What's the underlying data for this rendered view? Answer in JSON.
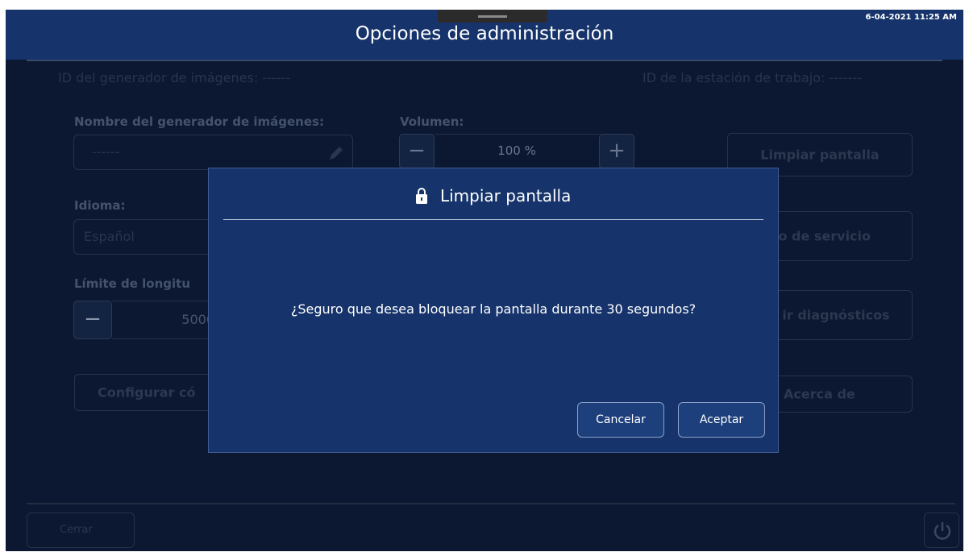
{
  "header": {
    "title": "Opciones de administración",
    "clock": "6-04-2021 11:25 AM"
  },
  "background": {
    "generator_id": "ID del generador de imágenes: ------",
    "workstation_id": "ID de la estación de trabajo: -------",
    "generator_name_label": "Nombre del generador de imágenes:",
    "generator_name_value": "------",
    "volume_label": "Volumen:",
    "volume_value": "100 %",
    "language_label": "Idioma:",
    "language_value": "Español",
    "length_limit_label": "Límite de longitu",
    "length_limit_value": "5000",
    "configure_button": "Configurar có",
    "clear_screen_button": "Limpiar pantalla",
    "service_mode_button": "do de servicio",
    "diagnostics_button": "ir diagnósticos",
    "about_button": "Acerca de",
    "close_button": "Cerrar",
    "minus_symbol": "−",
    "plus_symbol": "+"
  },
  "dialog": {
    "title": "Limpiar pantalla",
    "message": "¿Seguro que desea bloquear la pantalla durante 30 segundos?",
    "cancel": "Cancelar",
    "accept": "Aceptar",
    "icon": "lock-icon"
  },
  "colors": {
    "header_bg": "#16346b",
    "screen_bg": "#0c1831",
    "dialog_bg": "#16346b",
    "button_border": "#8aa0c6"
  }
}
